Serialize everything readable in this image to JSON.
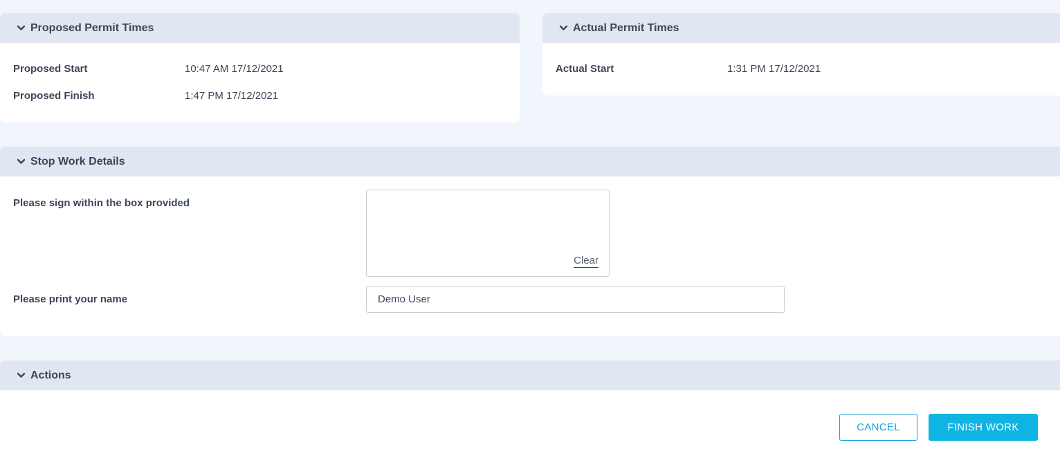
{
  "proposed": {
    "title": "Proposed Permit Times",
    "start_label": "Proposed Start",
    "start_value": "10:47 AM 17/12/2021",
    "finish_label": "Proposed Finish",
    "finish_value": "1:47 PM 17/12/2021"
  },
  "actual": {
    "title": "Actual Permit Times",
    "start_label": "Actual Start",
    "start_value": "1:31 PM 17/12/2021"
  },
  "stop_work": {
    "title": "Stop Work Details",
    "sign_label": "Please sign within the box provided",
    "clear_label": "Clear",
    "name_label": "Please print your name",
    "name_value": "Demo User"
  },
  "actions": {
    "title": "Actions",
    "cancel_label": "CANCEL",
    "finish_label": "FINISH WORK"
  },
  "colors": {
    "page_bg": "#f1f5fc",
    "header_bg": "#e1e7f2",
    "accent": "#0fb4e3"
  },
  "icons": {
    "section_toggle": "chevron-down-icon"
  }
}
